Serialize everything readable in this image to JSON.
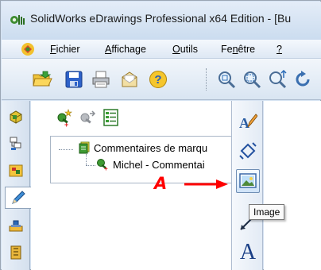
{
  "window": {
    "title": "SolidWorks eDrawings Professional x64 Edition - [Bu",
    "app_icon": "edrawings-logo-icon"
  },
  "menubar": {
    "items": [
      {
        "accel": "F",
        "rest": "ichier"
      },
      {
        "accel": "A",
        "rest": "ffichage"
      },
      {
        "accel": "O",
        "rest": "utils"
      },
      {
        "pre": "Fe",
        "accel": "n",
        "rest": "être"
      },
      {
        "accel": "?",
        "rest": ""
      }
    ]
  },
  "toolbar": {
    "buttons": [
      "open-icon",
      "save-icon",
      "print-icon",
      "send-mail-icon",
      "help-icon",
      "zoom-fit-icon",
      "zoom-area-icon",
      "zoom-in-out-icon",
      "rotate-icon"
    ]
  },
  "tabstrip": {
    "tabs": [
      "parts-tab-icon",
      "configurations-tab-icon",
      "components-tab-icon",
      "markup-tab-icon",
      "stamp-tab-icon",
      "measure-tab-icon"
    ],
    "active_index": 3
  },
  "panel": {
    "toolbar": [
      "new-comment-icon",
      "reply-comment-icon",
      "comment-list-icon"
    ],
    "tree": {
      "root": "Commentaires de marqu",
      "child": "Michel - Commentai"
    }
  },
  "markup_toolbar": {
    "buttons": [
      "text-pen-icon",
      "dimension-icon",
      "image-icon",
      "line-icon",
      "text-icon"
    ],
    "hover_index": 2
  },
  "tooltip": {
    "text": "Image"
  },
  "annotation": {
    "letter": "A",
    "color": "#ff0000"
  }
}
